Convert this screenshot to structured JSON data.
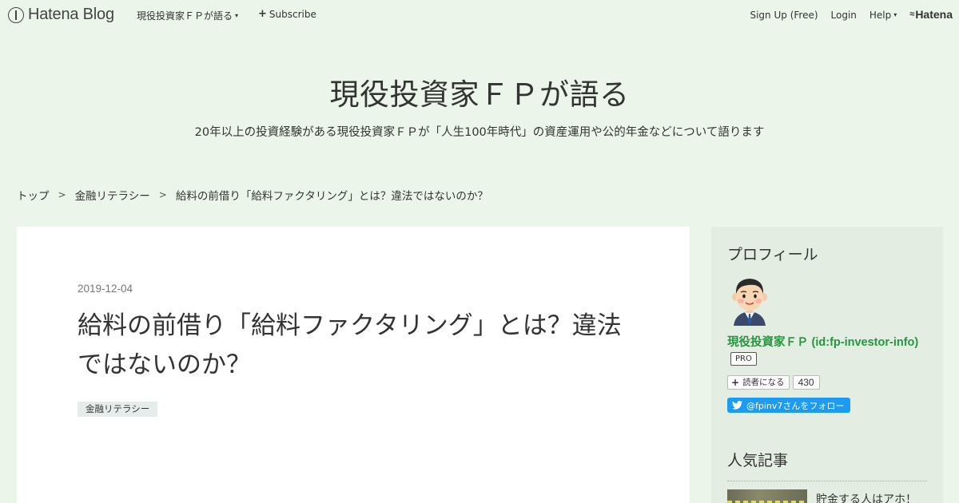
{
  "topbar": {
    "brand": "Hatena Blog",
    "blog_menu": "現役投資家ＦＰが語る",
    "subscribe": "Subscribe",
    "signup": "Sign Up (Free)",
    "login": "Login",
    "help": "Help",
    "hatena": "Hatena"
  },
  "blog": {
    "title": "現役投資家ＦＰが語る",
    "description": "20年以上の投資経験がある現役投資家ＦＰが「人生100年時代」の資産運用や公的年金などについて語ります"
  },
  "breadcrumb": {
    "items": [
      "トップ",
      "金融リテラシー",
      "給料の前借り「給料ファクタリング」とは？違法ではないのか？"
    ],
    "separator": ">"
  },
  "post": {
    "date": "2019-12-04",
    "title": "給料の前借り「給料ファクタリング」とは？違法ではないのか？",
    "category": "金融リテラシー"
  },
  "sidebar": {
    "profile_heading": "プロフィール",
    "profile_name": "現役投資家ＦＰ (id:fp-investor-info)",
    "pro_badge": "PRO",
    "reader_button": "読者になる",
    "reader_count": "430",
    "twitter_button": "@fpinv7さんをフォロー",
    "popular_heading": "人気記事",
    "popular_first_title": "貯金する人はアホ！"
  },
  "colors": {
    "background": "#ebf5ea",
    "profile_name": "#25953e",
    "twitter": "#1d9bf0"
  }
}
